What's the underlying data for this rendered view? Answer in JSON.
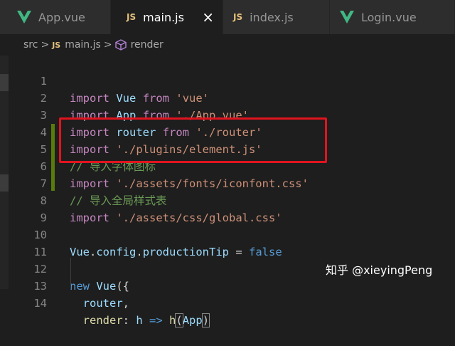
{
  "tabs": [
    {
      "label": "App.vue",
      "icon": "vue-icon",
      "active": false
    },
    {
      "label": "main.js",
      "icon": "js-icon",
      "active": true,
      "close": "×"
    },
    {
      "label": "index.js",
      "icon": "js-icon",
      "active": false
    },
    {
      "label": "Login.vue",
      "icon": "vue-icon",
      "active": false
    }
  ],
  "breadcrumb": {
    "folder": "src",
    "sep": ">",
    "js_badge": "JS",
    "file": "main.js",
    "symbol": "render"
  },
  "line_numbers": [
    "1",
    "2",
    "3",
    "4",
    "5",
    "6",
    "7",
    "8",
    "9",
    "10",
    "11",
    "12",
    "13",
    "14"
  ],
  "code": {
    "l1": {
      "kw1": "import",
      "id": "Vue",
      "kw2": "from",
      "str": "'vue'"
    },
    "l2": {
      "kw1": "import",
      "id": "App",
      "kw2": "from",
      "str": "'./App.vue'"
    },
    "l3": {
      "kw1": "import",
      "id": "router",
      "kw2": "from",
      "str": "'./router'"
    },
    "l4": {
      "kw1": "import",
      "str": "'./plugins/element.js'"
    },
    "l5": {
      "comment": "// 导入字体图标"
    },
    "l6": {
      "kw1": "import",
      "str": "'./assets/fonts/iconfont.css'"
    },
    "l7": {
      "comment": "// 导入全局样式表"
    },
    "l8": {
      "kw1": "import",
      "str": "'./assets/css/global.css'"
    },
    "l10": {
      "obj": "Vue",
      "dot1": ".",
      "prop1": "config",
      "dot2": ".",
      "prop2": "productionTip",
      "eq": " = ",
      "val": "false"
    },
    "l12": {
      "kw": "new",
      "cls": "Vue",
      "punc": "({"
    },
    "l13": {
      "prop": "router",
      "punc": ","
    },
    "l14": {
      "prop": "render",
      "colon": ": ",
      "param": "h",
      "arrow": " => ",
      "fn": "h",
      "open": "(",
      "arg": "App",
      "close": ")"
    }
  },
  "watermark": "知乎 @xieyingPeng",
  "colors": {
    "keyword": "#c586c0",
    "identifier": "#9cdcfe",
    "string": "#ce9178",
    "comment": "#6a9955",
    "highlight_box": "#e0141e",
    "git_gutter": "#587c0c"
  }
}
